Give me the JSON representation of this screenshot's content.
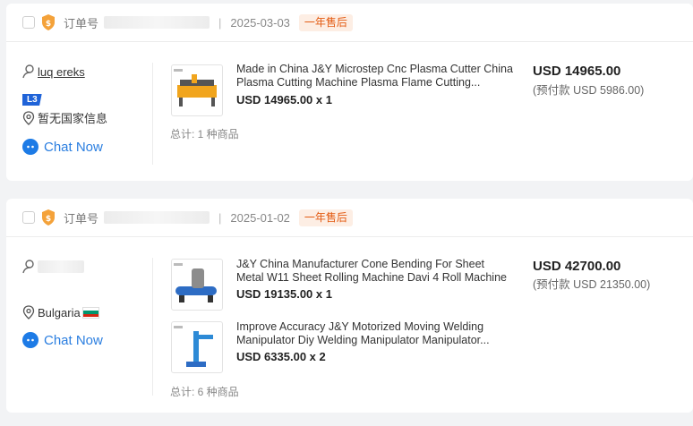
{
  "orders": [
    {
      "order_label": "订单号",
      "date": "2025-03-03",
      "warranty": "一年售后",
      "user_name": "luq ereks",
      "level": "L3",
      "location": "暂无国家信息",
      "chat": "Chat Now",
      "items": [
        {
          "title": "Made in China J&Y Microstep Cnc Plasma Cutter China Plasma Cutting Machine Plasma Flame Cutting...",
          "price": "USD 14965.00 x 1"
        }
      ],
      "total_line": "总计: 1 种商品",
      "amount": "USD 14965.00",
      "deposit": "(预付款 USD 5986.00)"
    },
    {
      "order_label": "订单号",
      "date": "2025-01-02",
      "warranty": "一年售后",
      "location": "Bulgaria",
      "chat": "Chat Now",
      "items": [
        {
          "title": "J&Y China Manufacturer Cone Bending For Sheet Metal W11 Sheet Rolling Machine Davi 4 Roll Machine",
          "price": "USD 19135.00 x 1"
        },
        {
          "title": "Improve Accuracy J&Y Motorized Moving Welding Manipulator Diy Welding Manipulator Manipulator...",
          "price": "USD 6335.00 x 2"
        }
      ],
      "total_line": "总计: 6 种商品",
      "amount": "USD 42700.00",
      "deposit": "(预付款 USD 21350.00)"
    }
  ],
  "colors": {
    "accent": "#e35b12",
    "link": "#2a7ee0",
    "badge": "#1f63d8"
  },
  "icons": [
    "shield-icon",
    "user-icon",
    "location-icon",
    "chat-icon",
    "bulgaria-flag-icon"
  ]
}
